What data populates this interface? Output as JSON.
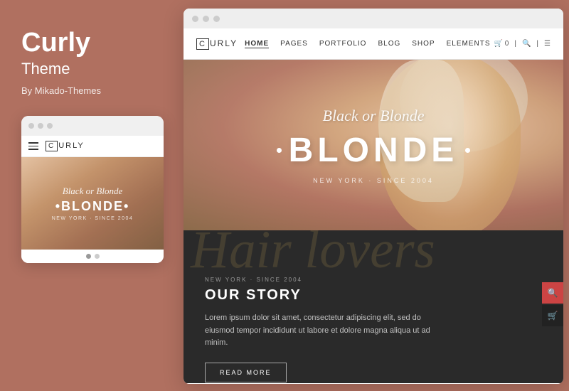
{
  "left": {
    "brand_name": "Curly",
    "brand_subtitle": "Theme",
    "brand_author": "By Mikado-Themes",
    "mobile_logo_box": "C",
    "mobile_logo_text": "URLY",
    "mobile_hero_script": "Black or Blonde",
    "mobile_hero_main": "•BLONDE•",
    "mobile_hero_sub": "NEW YORK · SINCE 2004"
  },
  "desktop": {
    "topbar_dots": [
      "",
      "",
      ""
    ],
    "logo_box": "C",
    "logo_text": "URLY",
    "nav_links": [
      "HOME",
      "PAGES",
      "PORTFOLIO",
      "BLOG",
      "SHOP",
      "ELEMENTS"
    ],
    "active_nav": "HOME",
    "hero_script": "Black or Blonde",
    "hero_main": "BLONDE",
    "hero_sub": "NEW YORK · SINCE 2004",
    "dark_bg_text": "Hair lovers",
    "dark_eyebrow": "NEW YORK · SINCE 2004",
    "dark_title": "OUR STORY",
    "dark_body": "Lorem ipsum dolor sit amet, consectetur adipiscing elit, sed do eiusmod tempor incididunt ut labore et dolore magna aliqua ut ad minim.",
    "dark_button": "READ MORE"
  }
}
